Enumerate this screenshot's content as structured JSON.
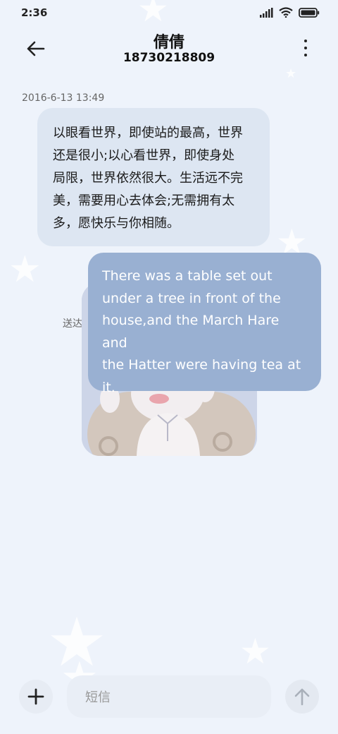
{
  "status_bar": {
    "time": "2:36"
  },
  "header": {
    "title": "倩倩",
    "phone": "18730218809"
  },
  "conversation": {
    "timestamp": "2016-6-13 13:49",
    "incoming_lines": [
      "以眼看世界，即使站的最高，世界",
      "还是很小;以心看世界，即使身处",
      "局限，世界依然很大。生活远不完",
      "美，需要用心去体会;无需拥有太",
      "多，愿快乐与你相随。"
    ],
    "outgoing_lines": [
      "There was a table set out",
      "under a tree in front of the",
      "house,and the March Hare and",
      "the Hatter were having tea at",
      "it."
    ],
    "sticker_status": "送达"
  },
  "composer": {
    "placeholder": "短信"
  },
  "colors": {
    "background": "#eef3fb",
    "incoming_bubble": "#dde6f2",
    "outgoing_bubble": "#99b0d2"
  }
}
